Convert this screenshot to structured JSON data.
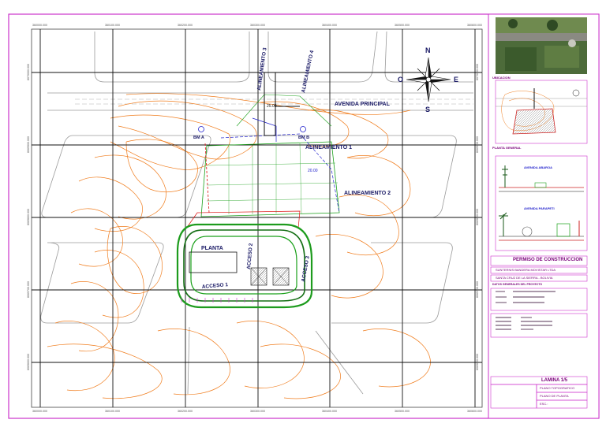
{
  "plan": {
    "labels": {
      "avenida": "AVENIDA PRINCIPAL",
      "alineamiento1": "ALINEAMIENTO 1",
      "alineamiento2": "ALINEAMIENTO 2",
      "alineamiento3": "ALINEAMIENTO 3",
      "alineamiento4": "ALINEAMIENTO 4",
      "planta": "PLANTA",
      "acceso1": "ACCESO 1",
      "acceso2": "ACCESO 2",
      "acceso3": "ACCESO 3",
      "bma": "BM A",
      "bmb": "BM B",
      "dim1": "20.00",
      "dim2": "25.00"
    },
    "compass": {
      "n": "N",
      "s": "S",
      "e": "E",
      "o": "O"
    },
    "grid_top": [
      "360000.000",
      "360100.000",
      "360200.000",
      "360300.000",
      "360400.000",
      "360500.000",
      "360600.000"
    ],
    "grid_left": [
      "8070000.000",
      "8069900.000",
      "8069800.000",
      "8069700.000",
      "8069600.000"
    ],
    "colors": {
      "border": "#cc33cc",
      "contour": "#f07d1e",
      "grid": "#111111",
      "green": "#1aa01a",
      "blue": "#2020cc",
      "red": "#dd1111"
    }
  },
  "titleblock": {
    "ubicacion": "UBICACION",
    "planta_general": "PLANTA GENERAL",
    "seccion_a": "AVENIDA ABAROA",
    "seccion_b": "AVENIDA PARAPETI",
    "permiso": "PERMISO DE CONSTRUCCION",
    "empresa": "SUNTERNIS BANDERA MOVISTAR LTDA",
    "lugar": "SANTA CRUZ DE LA SIERRA - BOLIVIA",
    "dir_title": "DATOS GENERALES DEL PROYECTO",
    "lamina": "LAMINA 1/5",
    "p1": "PLANO TOPOGRAFICO",
    "p2": "PLANO DE PLANTA",
    "p3": "ESC.:"
  }
}
